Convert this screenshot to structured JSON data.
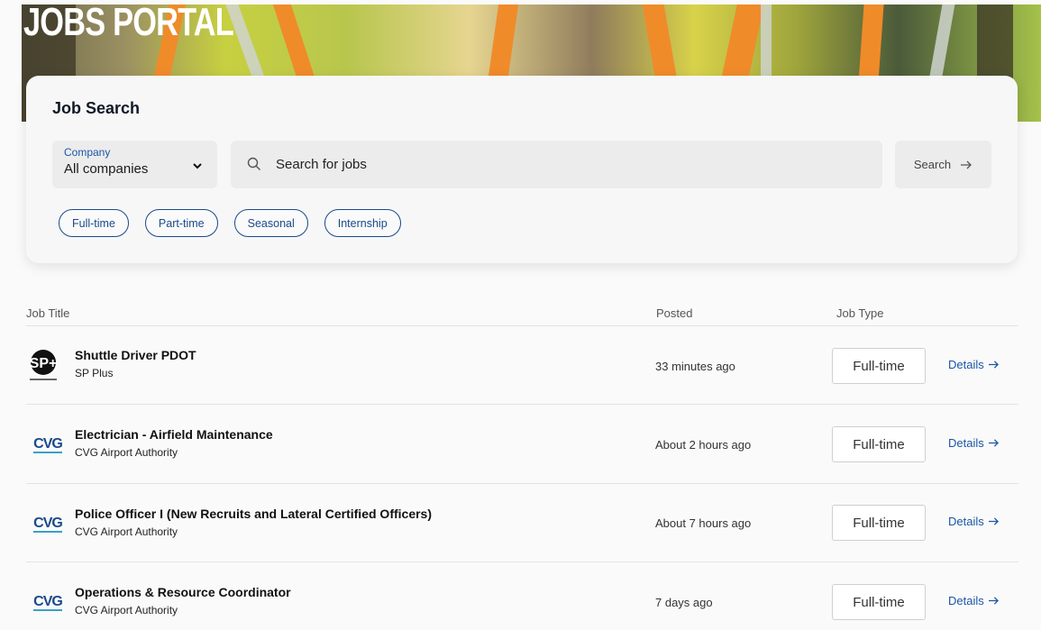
{
  "brand": {
    "title": "JOBS PORTAL"
  },
  "search_card": {
    "heading": "Job Search",
    "company_label": "Company",
    "company_value": "All companies",
    "search_placeholder": "Search for jobs",
    "search_button": "Search",
    "chips": [
      "Full-time",
      "Part-time",
      "Seasonal",
      "Internship"
    ]
  },
  "table": {
    "headers": {
      "job_title": "Job Title",
      "posted": "Posted",
      "job_type": "Job Type"
    },
    "rows": [
      {
        "title": "Shuttle Driver PDOT",
        "company": "SP Plus",
        "posted": "33 minutes ago",
        "type": "Full-time",
        "details": "Details",
        "logo": "sp-plus-logo",
        "logo_text": "SP+"
      },
      {
        "title": "Electrician - Airfield Maintenance",
        "company": "CVG Airport Authority",
        "posted": "About 2 hours ago",
        "type": "Full-time",
        "details": "Details",
        "logo": "cvg-logo",
        "logo_text": "CVG"
      },
      {
        "title": "Police Officer I (New Recruits and Lateral Certified Officers)",
        "company": "CVG Airport Authority",
        "posted": "About 7 hours ago",
        "type": "Full-time",
        "details": "Details",
        "logo": "cvg-logo",
        "logo_text": "CVG"
      },
      {
        "title": "Operations & Resource Coordinator",
        "company": "CVG Airport Authority",
        "posted": "7 days ago",
        "type": "Full-time",
        "details": "Details",
        "logo": "cvg-logo",
        "logo_text": "CVG"
      }
    ]
  },
  "colors": {
    "accent": "#1a56a6",
    "chip_border": "#1a4a8a",
    "hero_orange": "#f08b2a",
    "hero_lime": "#c7d040"
  }
}
